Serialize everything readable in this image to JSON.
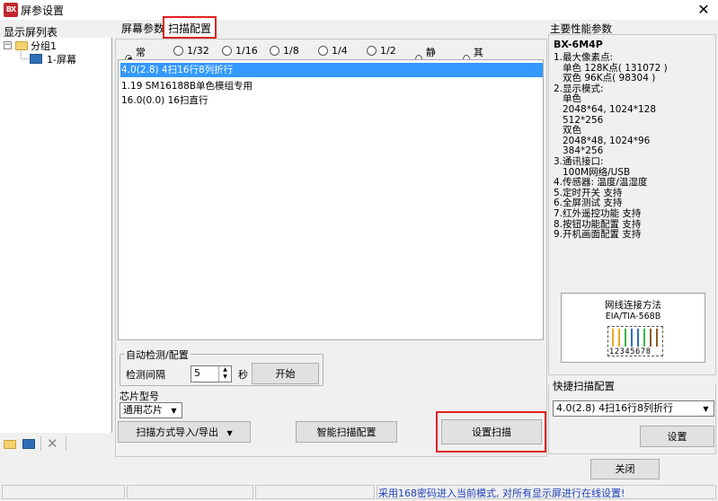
{
  "window": {
    "title": "屏参设置",
    "app_icon_text": "BX",
    "close_label": "✕"
  },
  "left": {
    "header": "显示屏列表",
    "tree": {
      "group": "分组1",
      "screen": "1-屏幕"
    }
  },
  "tabs": {
    "screen_params": "屏幕参数",
    "scan_config": "扫描配置"
  },
  "radios": [
    {
      "label": "常见",
      "checked": true
    },
    {
      "label": "1/32",
      "checked": false
    },
    {
      "label": "1/16",
      "checked": false
    },
    {
      "label": "1/8",
      "checked": false
    },
    {
      "label": "1/4",
      "checked": false
    },
    {
      "label": "1/2",
      "checked": false
    },
    {
      "label": "静态",
      "checked": false
    },
    {
      "label": "其他",
      "checked": false
    }
  ],
  "scan_list": [
    "4.0(2.8) 4扫16行8列折行",
    "1.19 SM16188B单色模组专用",
    "16.0(0.0) 16扫直行"
  ],
  "auto_detect": {
    "title": "自动检测/配置",
    "interval_label": "检测间隔",
    "interval_value": "5",
    "unit": "秒",
    "start_button": "开始"
  },
  "chip": {
    "label": "芯片型号",
    "value": "通用芯片"
  },
  "buttons": {
    "import_export": "扫描方式导入/导出",
    "smart_scan": "智能扫描配置",
    "set_scan": "设置扫描",
    "quick_set": "设置",
    "close": "关闭"
  },
  "spec": {
    "title": "主要性能参数",
    "model": "BX-6M4P",
    "lines": [
      "1.最大像素点:",
      "  单色 128K点( 131072 )",
      "  双色 96K点( 98304 )",
      "2.显示模式:",
      "  单色",
      "  2048*64, 1024*128",
      "  512*256",
      "  双色",
      "  2048*48, 1024*96",
      "  384*256",
      "3.通讯接口:",
      "  100M网络/USB",
      "4.传感器: 温度/温湿度",
      "5.定时开关 支持",
      "6.全屏测试 支持",
      "7.红外遥控功能 支持",
      "8.按钮功能配置 支持",
      "9.开机画面配置 支持"
    ],
    "wire_title": "网线连接方法",
    "wire_standard": "EIA/TIA-568B",
    "wire_pins": "12345678",
    "wire_colors": [
      "#f5a623",
      "#f5a623",
      "#3cb44b",
      "#2f6fb8",
      "#2f6fb8",
      "#3cb44b",
      "#8b5a2b",
      "#8b5a2b"
    ]
  },
  "quick_scan": {
    "title": "快捷扫描配置",
    "value": "4.0(2.8) 4扫16行8列折行"
  },
  "status": {
    "message": "采用168密码进入当前模式, 对所有显示屏进行在线设置!"
  }
}
